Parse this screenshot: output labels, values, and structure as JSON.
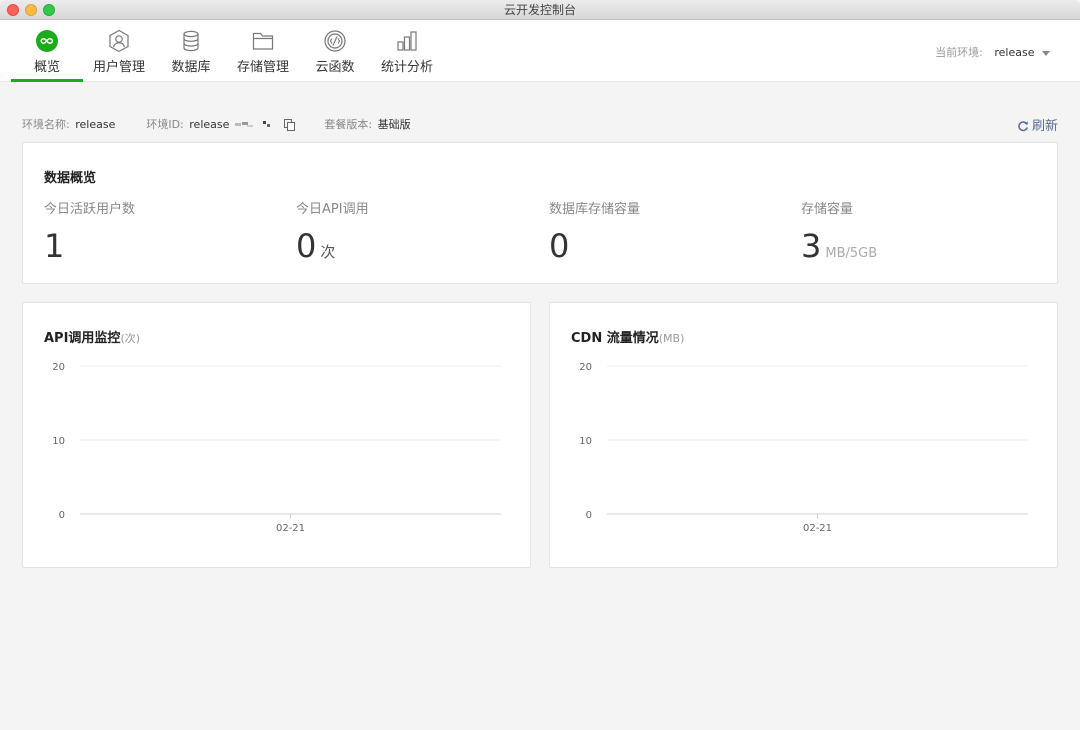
{
  "window": {
    "title": "云开发控制台"
  },
  "tabs": [
    {
      "label": "概览",
      "icon": "infinity-icon",
      "active": true
    },
    {
      "label": "用户管理",
      "icon": "user-icon",
      "active": false
    },
    {
      "label": "数据库",
      "icon": "database-icon",
      "active": false
    },
    {
      "label": "存储管理",
      "icon": "folder-icon",
      "active": false
    },
    {
      "label": "云函数",
      "icon": "function-icon",
      "active": false
    },
    {
      "label": "统计分析",
      "icon": "bar-chart-icon",
      "active": false
    }
  ],
  "env_select": {
    "label": "当前环境:",
    "value": "release"
  },
  "info": {
    "env_name_label": "环境名称:",
    "env_name_value": "release",
    "env_id_label": "环境ID:",
    "env_id_value": "release",
    "plan_label": "套餐版本:",
    "plan_value": "基础版",
    "refresh_label": "刷新"
  },
  "overview": {
    "title": "数据概览",
    "stats": [
      {
        "label": "今日活跃用户数",
        "value": "1",
        "unit": ""
      },
      {
        "label": "今日API调用",
        "value": "0",
        "unit": "次"
      },
      {
        "label": "数据库存储容量",
        "value": "0",
        "unit": ""
      },
      {
        "label": "存储容量",
        "value": "3",
        "unit": "MB/5GB"
      }
    ]
  },
  "colors": {
    "accent": "#1aad19",
    "link": "#576b95"
  },
  "chart_data": [
    {
      "type": "line",
      "title": "API调用监控",
      "unit": "(次)",
      "x": [
        "02-21"
      ],
      "series": [
        {
          "values": [
            0
          ]
        }
      ],
      "ylim": [
        0,
        20
      ],
      "yticks": [
        0,
        10,
        20
      ],
      "grid": true
    },
    {
      "type": "line",
      "title": "CDN 流量情况",
      "unit": "(MB)",
      "x": [
        "02-21"
      ],
      "series": [
        {
          "values": [
            0
          ]
        }
      ],
      "ylim": [
        0,
        20
      ],
      "yticks": [
        0,
        10,
        20
      ],
      "grid": true
    }
  ]
}
